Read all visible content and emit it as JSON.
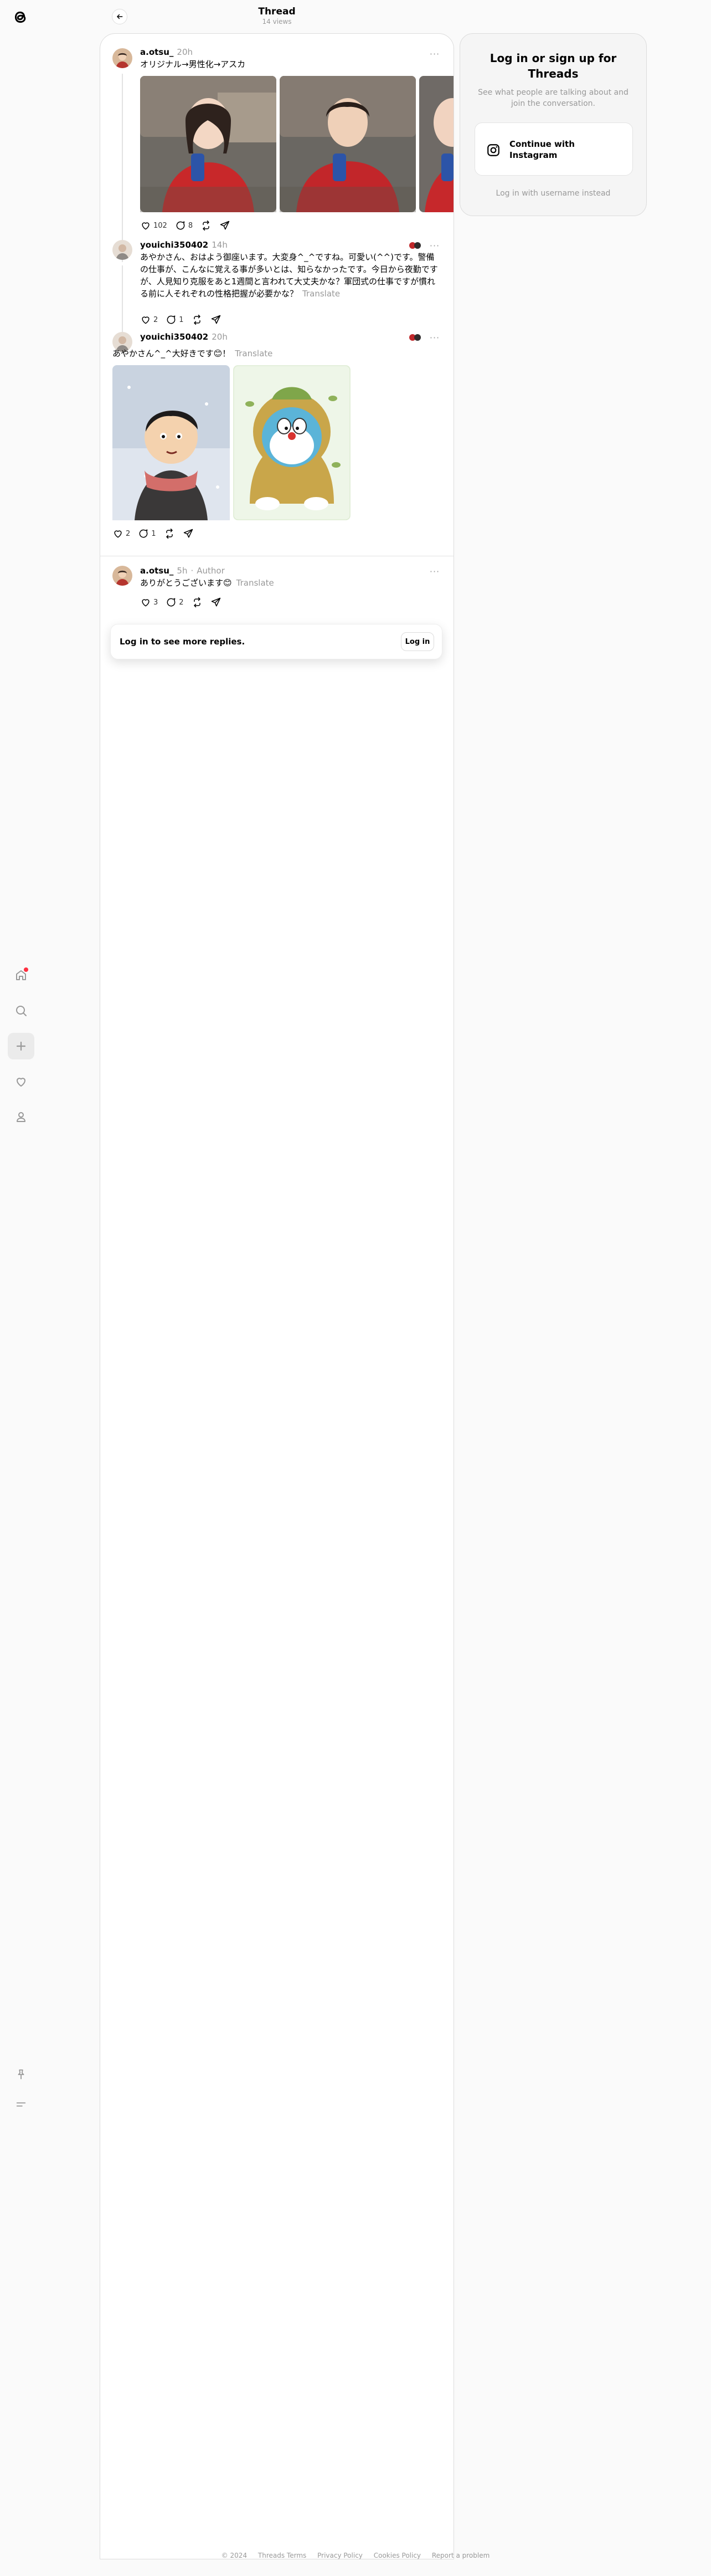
{
  "header": {
    "title": "Thread",
    "subtitle": "14 views"
  },
  "posts": [
    {
      "username": "a.otsu_",
      "time": "20h",
      "text": "オリジナル→男性化→アスカ",
      "likes": "102",
      "replies": "8"
    },
    {
      "username": "youichi350402",
      "time": "14h",
      "text": "あやかさん、おはよう御座います。大変身^_^ですね。可愛い(^^)です。警備の仕事が、こんなに覚える事が多いとは、知らなかったです。今日から夜勤ですが、人見知り克服をあと1週間と言われて大丈夫かな？軍団式の仕事ですが慣れる前に人それぞれの性格把握が必要かな？",
      "translate": "Translate",
      "likes": "2",
      "replies": "1"
    },
    {
      "username": "youichi350402",
      "time": "20h",
      "text": "あやかさん^_^大好きです😊！",
      "translate": "Translate",
      "likes": "2",
      "replies": "1"
    },
    {
      "username": "a.otsu_",
      "time": "5h",
      "author_tag": "Author",
      "text": "ありがとうございます😊",
      "translate": "Translate",
      "likes": "3",
      "replies": "2"
    }
  ],
  "login_prompt": {
    "text": "Log in to see more replies.",
    "button": "Log in"
  },
  "panel": {
    "title": "Log in or sign up for Threads",
    "subtitle": "See what people are talking about and join the conversation.",
    "button": "Continue with Instagram",
    "link": "Log in with username instead"
  },
  "footer": [
    "© 2024",
    "Threads Terms",
    "Privacy Policy",
    "Cookies Policy",
    "Report a problem"
  ],
  "nav_icons": [
    "home-icon",
    "search-icon",
    "create-icon",
    "heart-icon",
    "profile-icon",
    "pin-icon",
    "menu-icon"
  ]
}
